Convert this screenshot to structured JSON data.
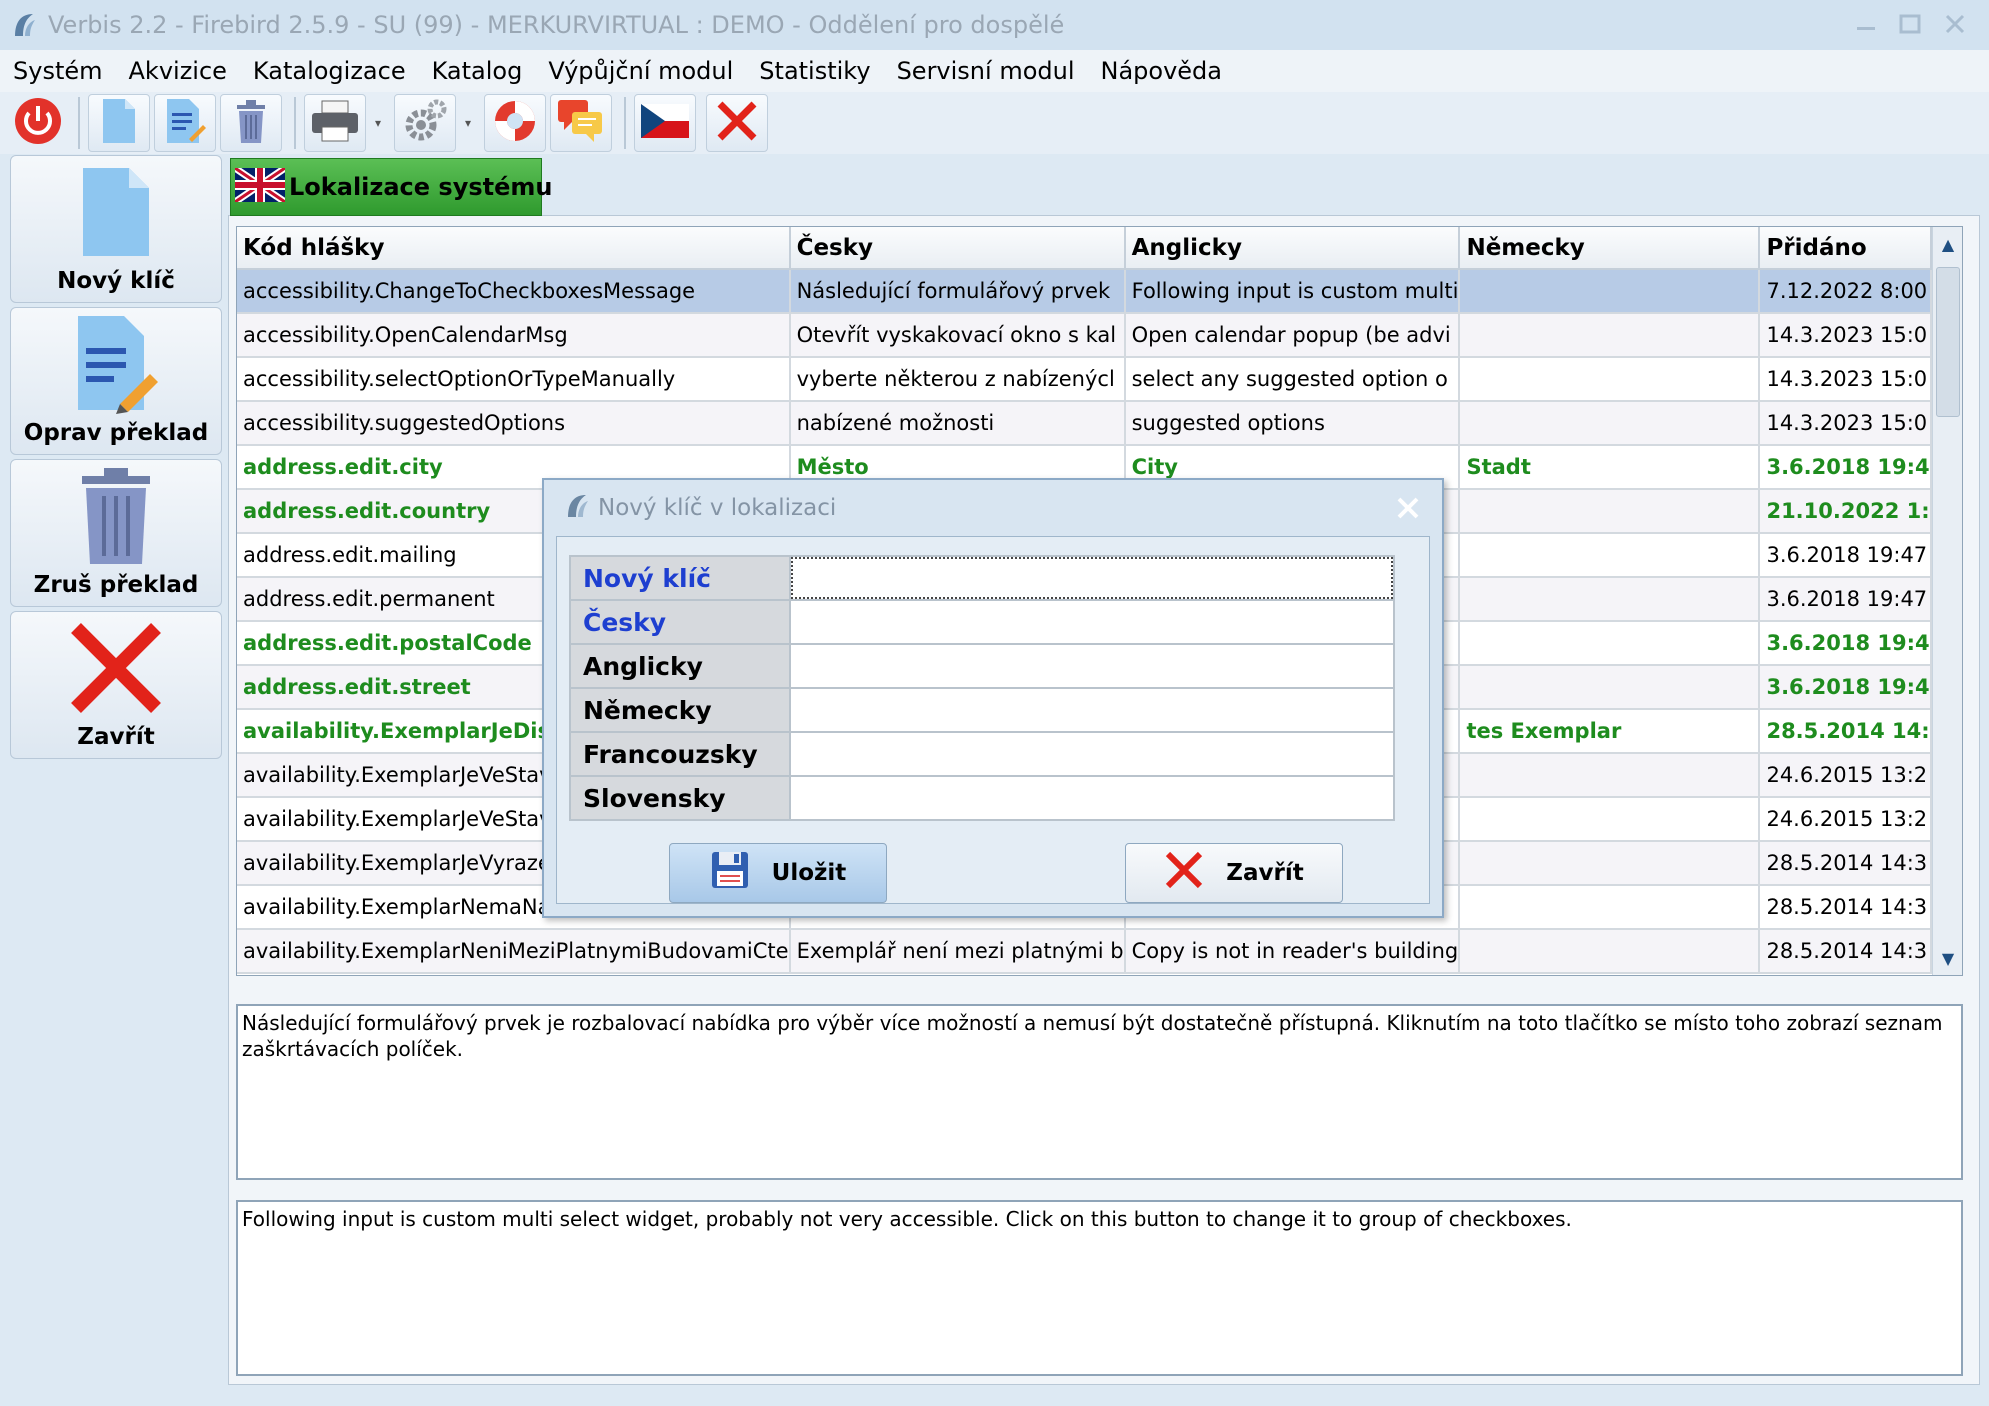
{
  "window": {
    "title": "Verbis 2.2 - Firebird 2.5.9 - SU (99) - MERKURVIRTUAL : DEMO - Oddělení pro dospělé",
    "minimize_icon": "minimize-icon",
    "maximize_icon": "maximize-icon",
    "close_icon": "close-icon"
  },
  "menu": {
    "items": [
      "Systém",
      "Akvizice",
      "Katalogizace",
      "Katalog",
      "Výpůjční modul",
      "Statistiky",
      "Servisní modul",
      "Nápověda"
    ]
  },
  "toolbar": {
    "icons": [
      "power-icon",
      "new-document-icon",
      "edit-document-icon",
      "trash-icon",
      "printer-icon",
      "gear-icon",
      "lifebuoy-icon",
      "chat-icon",
      "czech-flag-icon",
      "close-x-icon"
    ]
  },
  "sidebar": {
    "items": [
      {
        "label": "Nový klíč",
        "icon": "new-document-icon"
      },
      {
        "label": "Oprav překlad",
        "icon": "edit-document-icon"
      },
      {
        "label": "Zruš překlad",
        "icon": "trash-icon"
      },
      {
        "label": "Zavřít",
        "icon": "close-x-icon"
      }
    ]
  },
  "tab": {
    "label": "Lokalizace systému",
    "icon": "uk-flag-icon"
  },
  "grid": {
    "columns": [
      "Kód hlášky",
      "Česky",
      "Anglicky",
      "Německy",
      "Přidáno"
    ],
    "rows": [
      {
        "key": "accessibility.ChangeToCheckboxesMessage",
        "cs": "Následující formulářový prvek",
        "en": "Following input is custom multi",
        "de": "",
        "added": "7.12.2022 8:00",
        "style": "selected"
      },
      {
        "key": "accessibility.OpenCalendarMsg",
        "cs": "Otevřít vyskakovací okno s kal",
        "en": "Open calendar popup (be advi",
        "de": "",
        "added": "14.3.2023 15:0",
        "style": "alt"
      },
      {
        "key": "accessibility.selectOptionOrTypeManually",
        "cs": "vyberte některou z nabízenýcl",
        "en": "select any suggested option o",
        "de": "",
        "added": "14.3.2023 15:0",
        "style": ""
      },
      {
        "key": "accessibility.suggestedOptions",
        "cs": "nabízené možnosti",
        "en": "suggested options",
        "de": "",
        "added": "14.3.2023 15:0",
        "style": "alt"
      },
      {
        "key": "address.edit.city",
        "cs": "Město",
        "en": "City",
        "de": "Stadt",
        "added": "3.6.2018 19:4",
        "style": "green"
      },
      {
        "key": "address.edit.country",
        "cs": "",
        "en": "",
        "de": "",
        "added": "21.10.2022 1:",
        "style": "green alt"
      },
      {
        "key": "address.edit.mailing",
        "cs": "",
        "en": "",
        "de": "",
        "added": "3.6.2018 19:47",
        "style": ""
      },
      {
        "key": "address.edit.permanent",
        "cs": "",
        "en": "",
        "de": "",
        "added": "3.6.2018 19:47",
        "style": "alt"
      },
      {
        "key": "address.edit.postalCode",
        "cs": "",
        "en": "",
        "de": "",
        "added": "3.6.2018 19:4",
        "style": "green"
      },
      {
        "key": "address.edit.street",
        "cs": "",
        "en": "",
        "de": "",
        "added": "3.6.2018 19:4",
        "style": "green alt"
      },
      {
        "key": "availability.ExemplarJeDisl",
        "cs": "",
        "en": "",
        "de": "tes Exemplar",
        "added": "28.5.2014 14:",
        "style": "green"
      },
      {
        "key": "availability.ExemplarJeVeStavu",
        "cs": "",
        "en": "",
        "de": "",
        "added": "24.6.2015 13:2",
        "style": "alt"
      },
      {
        "key": "availability.ExemplarJeVeStavu",
        "cs": "",
        "en": "",
        "de": "",
        "added": "24.6.2015 13:2",
        "style": ""
      },
      {
        "key": "availability.ExemplarJeVyrazen",
        "cs": "",
        "en": "",
        "de": "",
        "added": "28.5.2014 14:3",
        "style": "alt"
      },
      {
        "key": "availability.ExemplarNemaNasta",
        "cs": "",
        "en": "",
        "de": "",
        "added": "28.5.2014 14:3",
        "style": ""
      },
      {
        "key": "availability.ExemplarNeniMeziPlatnymiBudovamiCte",
        "cs": "Exemplář není mezi platnými b",
        "en": "Copy is not in reader's building",
        "de": "",
        "added": "28.5.2014 14:3",
        "style": "alt"
      }
    ]
  },
  "detail": {
    "czech_text": "Následující formulářový prvek je rozbalovací nabídka pro výběr více možností a nemusí být dostatečně přístupná. Kliknutím na toto tlačítko se místo toho zobrazí seznam zaškrtávacích políček.",
    "english_text": "Following input is custom multi select widget, probably not very accessible. Click on this button to change it to group of checkboxes."
  },
  "dialog": {
    "title": "Nový klíč v lokalizaci",
    "fields": [
      {
        "label": "Nový klíč",
        "value": "",
        "required": true
      },
      {
        "label": "Česky",
        "value": "",
        "required": true
      },
      {
        "label": "Anglicky",
        "value": "",
        "required": false
      },
      {
        "label": "Německy",
        "value": "",
        "required": false
      },
      {
        "label": "Francouzsky",
        "value": "",
        "required": false
      },
      {
        "label": "Slovensky",
        "value": "",
        "required": false
      }
    ],
    "save_label": "Uložit",
    "close_label": "Zavřít"
  },
  "colors": {
    "required_label": "#1e3fd0",
    "green_row": "#1e8c1e",
    "selected_row": "#b7cbe6",
    "tab_green": "#3aa83a"
  }
}
